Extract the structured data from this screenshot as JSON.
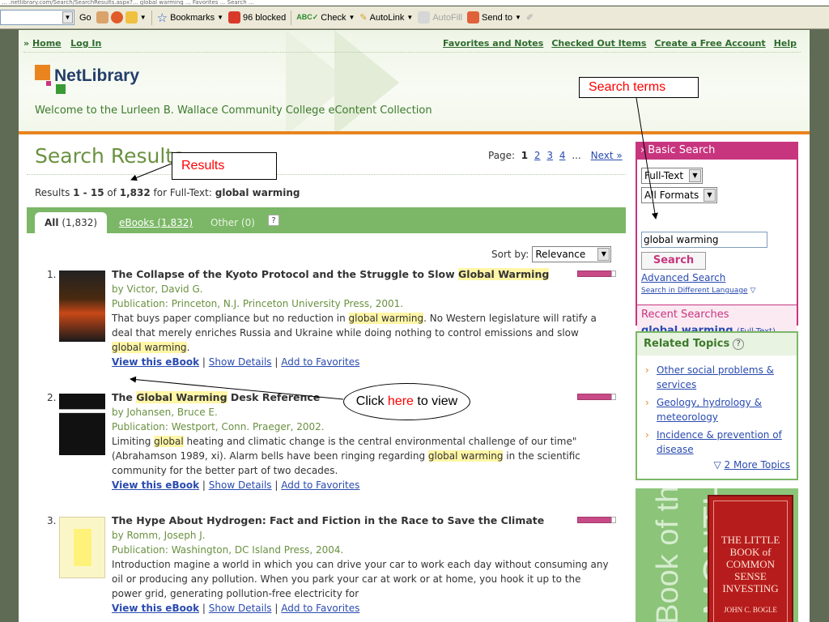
{
  "url_strip": "... .netlibrary.com/Search/SearchResults.aspx?... global warming ... Favorites ... Search ...",
  "toolbar": {
    "go_label": "Go",
    "bookmarks_label": "Bookmarks",
    "blocked_label": "96 blocked",
    "check_label": "Check",
    "autolink_label": "AutoLink",
    "autofill_label": "AutoFill",
    "sendto_label": "Send to"
  },
  "topnav": {
    "prefix": "»",
    "home": "Home",
    "login": "Log In",
    "right_links": [
      "Favorites and Notes",
      "Checked Out Items",
      "Create a Free Account",
      "Help"
    ]
  },
  "logo_text": "NetLibrary",
  "welcome": "Welcome to the Lurleen B. Wallace Community College eContent Collection",
  "search_results_title": "Search Results",
  "pager": {
    "label": "Page:",
    "current": "1",
    "pages": [
      "2",
      "3",
      "4"
    ],
    "ellipsis": "...",
    "next": "Next »"
  },
  "results_summary": {
    "prefix": "Results ",
    "range": "1 - 15",
    "of": " of ",
    "total": "1,832",
    "for": " for Full-Text: ",
    "query": "global warming"
  },
  "tabs": {
    "all_label": "All",
    "all_count": "(1,832)",
    "ebooks_label": "eBooks (1,832)",
    "other_label": "Other (0)",
    "help": "?"
  },
  "sort": {
    "label": "Sort by:",
    "value": "Relevance"
  },
  "results": [
    {
      "num": "1.",
      "title_pre": "The Collapse of the Kyoto Protocol and the Struggle to Slow ",
      "title_hl": "Global Warming",
      "author": "by Victor, David G.",
      "publication": "Publication: Princeton, N.J. Princeton University Press, 2001.",
      "desc_1": "That buys paper compliance but no reduction in ",
      "desc_hl1": "global warming",
      "desc_2": ". No Western legislature will ratify a deal that merely enriches Russia and Ukraine while doing nothing to control emissions and slow ",
      "desc_hl2": "global warming",
      "desc_3": "."
    },
    {
      "num": "2.",
      "title_pre": "The ",
      "title_hl": "Global Warming",
      "title_post": " Desk Reference",
      "author": "by Johansen, Bruce E.",
      "publication": "Publication: Westport, Conn. Praeger, 2002.",
      "desc_1": "Limiting ",
      "desc_hl1": "global",
      "desc_2": " heating and climatic change is the central environmental challenge of our time\" (Abrahamson 1989, xi). Alarm bells have been ringing regarding ",
      "desc_hl2": "global warming",
      "desc_3": " in the scientific community for the better part of two decades."
    },
    {
      "num": "3.",
      "title": "The Hype About Hydrogen: Fact and Fiction in the Race to Save the Climate",
      "author": "by Romm, Joseph J.",
      "publication": "Publication: Washington, DC Island Press, 2004.",
      "desc": "Introduction magine a world in which you can drive your car to work each day without consuming any oil or producing any pollution. When you park your car at work or at home, you hook it up to the power grid, generating pollution-free electricity for"
    }
  ],
  "actions": {
    "view": "View this eBook",
    "details": "Show Details",
    "favorites": "Add to Favorites",
    "sep": "|"
  },
  "basic_search": {
    "heading": "Basic Search",
    "type_select": "Full-Text",
    "format_select": "All Formats",
    "query": "global warming",
    "button": "Search",
    "advanced": "Advanced Search",
    "different_language": "Search in Different Language"
  },
  "recent_searches": {
    "heading": "Recent Searches",
    "item": "global warming",
    "item_scope": "(Full-Text)"
  },
  "related_topics": {
    "heading": "Related Topics",
    "help": "?",
    "items": [
      "Other social problems & services",
      "Geology, hydrology & meteorology",
      "Incidence & prevention of disease"
    ],
    "more": "2 More Topics"
  },
  "ebook_of_month": {
    "label_1": "eBook of the",
    "label_2": "MONTH",
    "cover_title": "THE LITTLE BOOK of COMMON SENSE INVESTING",
    "cover_author": "JOHN C. BOGLE"
  },
  "annotations": {
    "search_terms": "Search terms",
    "results": "Results",
    "click_pre": "Click ",
    "click_here": "here",
    "click_post": " to view"
  },
  "colors": {
    "green_accent": "#6a9140",
    "tab_green": "#7bb766",
    "magenta": "#c8357f",
    "orange": "#e9841f",
    "link_blue": "#2a4bb0",
    "highlight": "#fff6a6",
    "annotation_red": "#ff0000"
  }
}
